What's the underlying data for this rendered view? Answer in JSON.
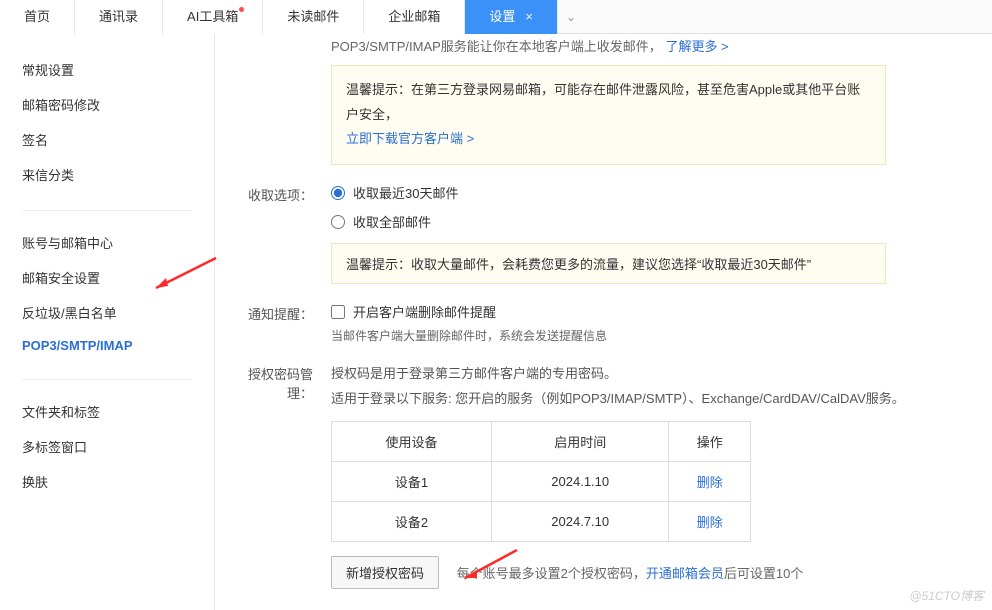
{
  "tabs": {
    "items": [
      {
        "label": "首页",
        "active": false,
        "dot": false
      },
      {
        "label": "通讯录",
        "active": false,
        "dot": false
      },
      {
        "label": "AI工具箱",
        "active": false,
        "dot": true
      },
      {
        "label": "未读邮件",
        "active": false,
        "dot": false
      },
      {
        "label": "企业邮箱",
        "active": false,
        "dot": false
      },
      {
        "label": "设置",
        "active": true,
        "dot": false
      }
    ],
    "close_glyph": "×",
    "drop_glyph": "⌄"
  },
  "sidebar": {
    "group1": [
      {
        "label": "常规设置"
      },
      {
        "label": "邮箱密码修改"
      },
      {
        "label": "签名"
      },
      {
        "label": "来信分类"
      }
    ],
    "group2": [
      {
        "label": "账号与邮箱中心"
      },
      {
        "label": "邮箱安全设置"
      },
      {
        "label": "反垃圾/黑白名单"
      },
      {
        "label": "POP3/SMTP/IMAP",
        "active": true
      }
    ],
    "group3": [
      {
        "label": "文件夹和标签"
      },
      {
        "label": "多标签窗口"
      },
      {
        "label": "换肤"
      }
    ]
  },
  "top_cut_text": "POP3/SMTP/IMAP服务能让你在本地客户端上收发邮件，",
  "top_cut_link": "了解更多 >",
  "warning": {
    "prefix": "温馨提示：",
    "text": "在第三方登录网易邮箱，可能存在邮件泄露风险，甚至危害Apple或其他平台账户安全，",
    "link": "立即下载官方客户端 >"
  },
  "receive": {
    "label": "收取选项：",
    "opt1": "收取最近30天邮件",
    "opt2": "收取全部邮件",
    "tip_prefix": "温馨提示：",
    "tip_text": "收取大量邮件，会耗费您更多的流量，建议您选择“收取最近30天邮件”"
  },
  "notify": {
    "label": "通知提醒：",
    "checkbox": "开启客户端删除邮件提醒",
    "sub": "当邮件客户端大量删除邮件时，系统会发送提醒信息"
  },
  "auth": {
    "label": "授权密码管理：",
    "desc1": "授权码是用于登录第三方邮件客户端的专用密码。",
    "desc2": "适用于登录以下服务: 您开启的服务（例如POP3/IMAP/SMTP）、Exchange/CardDAV/CalDAV服务。",
    "headers": {
      "device": "使用设备",
      "time": "启用时间",
      "op": "操作"
    },
    "rows": [
      {
        "device": "设备1",
        "time": "2024.1.10",
        "op": "删除"
      },
      {
        "device": "设备2",
        "time": "2024.7.10",
        "op": "删除"
      }
    ],
    "add_btn": "新增授权密码",
    "after1": "每个账号最多设置2个授权密码，",
    "after_link": "开通邮箱会员",
    "after2": "后可设置10个"
  },
  "watermark": "@51CTO博客"
}
